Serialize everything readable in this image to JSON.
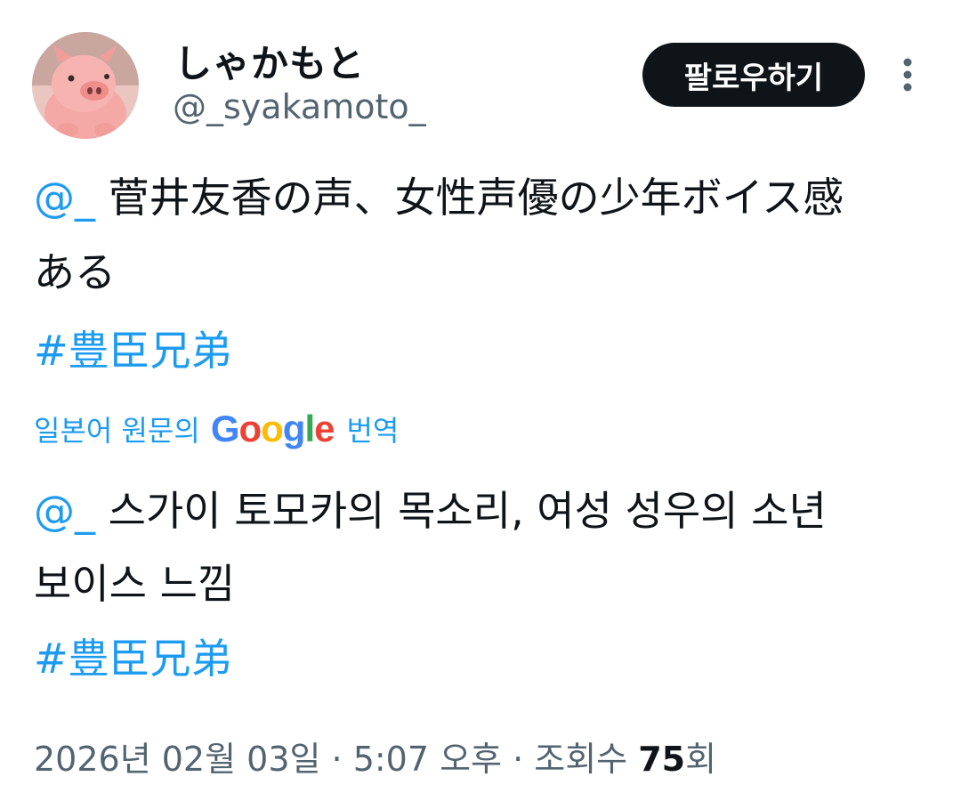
{
  "user": {
    "display_name": "しゃかもと",
    "handle": "@_syakamoto_",
    "avatar_icon": "pig-avatar"
  },
  "actions": {
    "follow_label": "팔로우하기",
    "more_icon": "more-vertical-icon"
  },
  "original": {
    "mention": "@_",
    "text_line1": " 菅井友香の声、女性声優の少年ボイス感",
    "text_line2": "ある",
    "hashtag": "#豊臣兄弟"
  },
  "translation": {
    "label_prefix": "일본어 원문의",
    "provider": "Google",
    "label_suffix": "번역",
    "mention": "@_",
    "text_line1": " 스가이 토모카의 목소리, 여성 성우의 소년",
    "text_line2": "보이스 느낌",
    "hashtag": "#豊臣兄弟"
  },
  "meta": {
    "timestamp": "2026년 02월 03일 · 5:07 오후 · 조회수 ",
    "views_count": "75",
    "views_suffix": "회"
  },
  "colors": {
    "link": "#1d9bf0",
    "secondary_text": "#536471",
    "button_bg": "#0f1419"
  }
}
